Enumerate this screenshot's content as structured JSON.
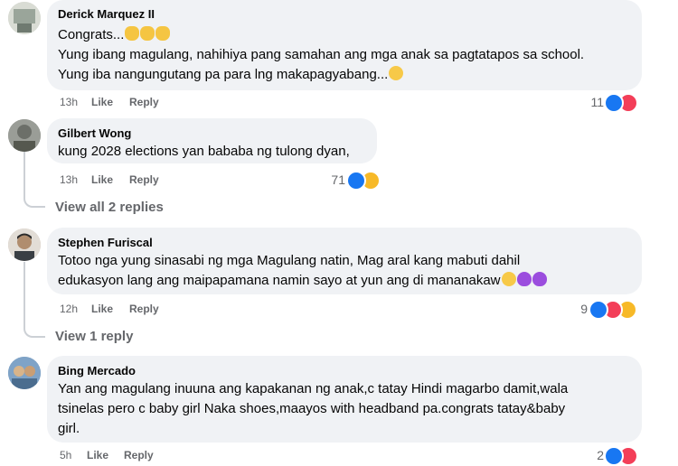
{
  "comments": [
    {
      "author": "Derick Marquez II",
      "lines": [
        "Congrats...",
        "Yung ibang magulang, nahihiya pang samahan ang mga anak sa pagtatapos sa school.",
        "Yung iba nangungutang pa para lng makapagyabang..."
      ],
      "emoji_icons": [
        "clapping-hands-emoji",
        "smiling-face-emoji"
      ],
      "time": "13h",
      "like": "Like",
      "reply": "Reply",
      "reaction_count": "11",
      "reactions": [
        "like",
        "love"
      ]
    },
    {
      "author": "Gilbert Wong",
      "lines": [
        "kung 2028 elections yan bababa ng tulong dyan,"
      ],
      "time": "13h",
      "like": "Like",
      "reply": "Reply",
      "reaction_count": "71",
      "reactions": [
        "like",
        "haha"
      ],
      "view_replies": "View all 2 replies"
    },
    {
      "author": "Stephen Furiscal",
      "lines": [
        "Totoo nga yung sinasabi ng mga Magulang natin, Mag aral kang mabuti dahil",
        "edukasyon lang ang maipapamana namin sayo at yun ang di mananakaw"
      ],
      "emoji_icons": [
        "face-emoji",
        "purple-heart-emoji"
      ],
      "time": "12h",
      "like": "Like",
      "reply": "Reply",
      "reaction_count": "9",
      "reactions": [
        "like",
        "love",
        "care"
      ],
      "view_replies": "View 1 reply"
    },
    {
      "author": "Bing Mercado",
      "lines": [
        "Yan ang magulang inuuna ang kapakanan ng anak,c tatay Hindi magarbo damit,wala",
        "tsinelas pero c baby girl Naka shoes,maayos with headband pa.congrats tatay&baby",
        "girl."
      ],
      "time": "5h",
      "like": "Like",
      "reply": "Reply",
      "reaction_count": "2",
      "reactions": [
        "like",
        "love"
      ]
    }
  ],
  "colors": {
    "like": "#1877f2",
    "love": "#f33e58",
    "bubble": "#f0f2f5",
    "meta": "#65676b"
  }
}
